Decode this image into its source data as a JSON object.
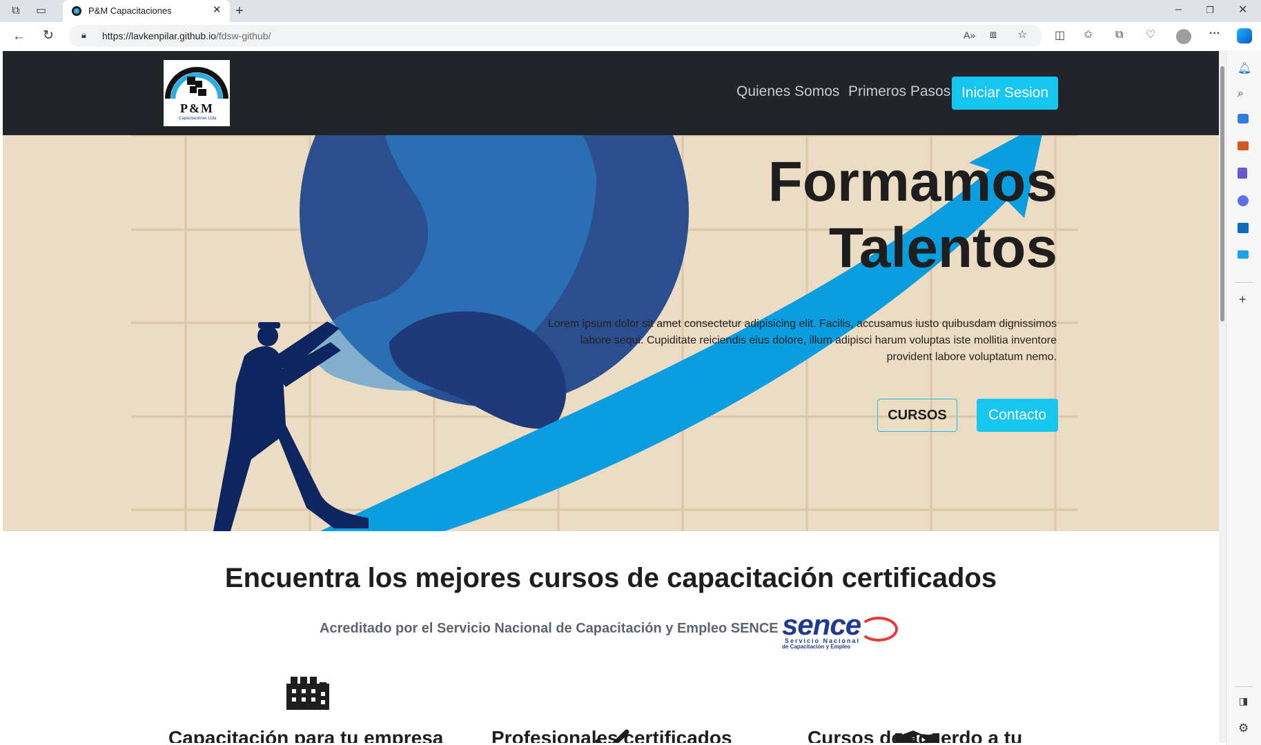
{
  "browser": {
    "tab_title": "P&M Capacitaciones",
    "url_host": "https://lavkenpilar.github.io",
    "url_path": "/fdsw-github/"
  },
  "nav": {
    "logo_text": "P&M",
    "logo_subtext": "Capacitaciones Ltda",
    "links": [
      "Quienes Somos",
      "Primeros Pasos"
    ],
    "login_label": "Iniciar Sesion"
  },
  "hero": {
    "title_line1": "Formamos",
    "title_line2": "Talentos",
    "description": "Lorem ipsum dolor sit amet consectetur adipisicing elit. Facilis, accusamus iusto quibusdam dignissimos labore sequi. Cupiditate reiciendis eius dolore, illum adipisci harum voluptas iste mollitia inventore provident labore voluptatum nemo.",
    "courses_button": "CURSOS",
    "contact_button": "Contacto"
  },
  "section": {
    "title": "Encuentra los mejores cursos de capacitación certificados",
    "subtitle": "Acreditado por el Servicio Nacional de Capacitación y Empleo SENCE",
    "sence_logo_text": "sence",
    "sence_logo_line1": "Servicio Nacional",
    "sence_logo_line2": "de Capacitación y Empleo"
  },
  "features": [
    {
      "icon": "building-icon",
      "title": "Capacitación para tu empresa"
    },
    {
      "icon": "check-icon",
      "title": "Profesionales certificados"
    },
    {
      "icon": "handshake-icon",
      "title": "Cursos de acuerdo a tu"
    }
  ],
  "colors": {
    "navbar": "#212529",
    "accent": "#15c6ee",
    "hero_bg": "#ecdcc3",
    "globe": "#2b4f8e",
    "arrow": "#0a9de0",
    "figure": "#0d2660"
  }
}
